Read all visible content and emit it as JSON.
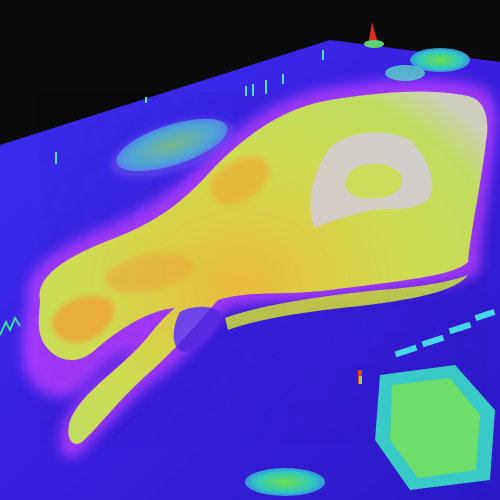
{
  "scene": {
    "description_free": true,
    "colormap": [
      "#1b0f7a",
      "#3a2cf0",
      "#6a3cff",
      "#c04dff",
      "#d8d8d0",
      "#a7e04a",
      "#d2e63a",
      "#f0b020",
      "#e8551a",
      "#d91a2a"
    ],
    "background": "#0a0a0a",
    "plane_color": "#3b22e6"
  }
}
